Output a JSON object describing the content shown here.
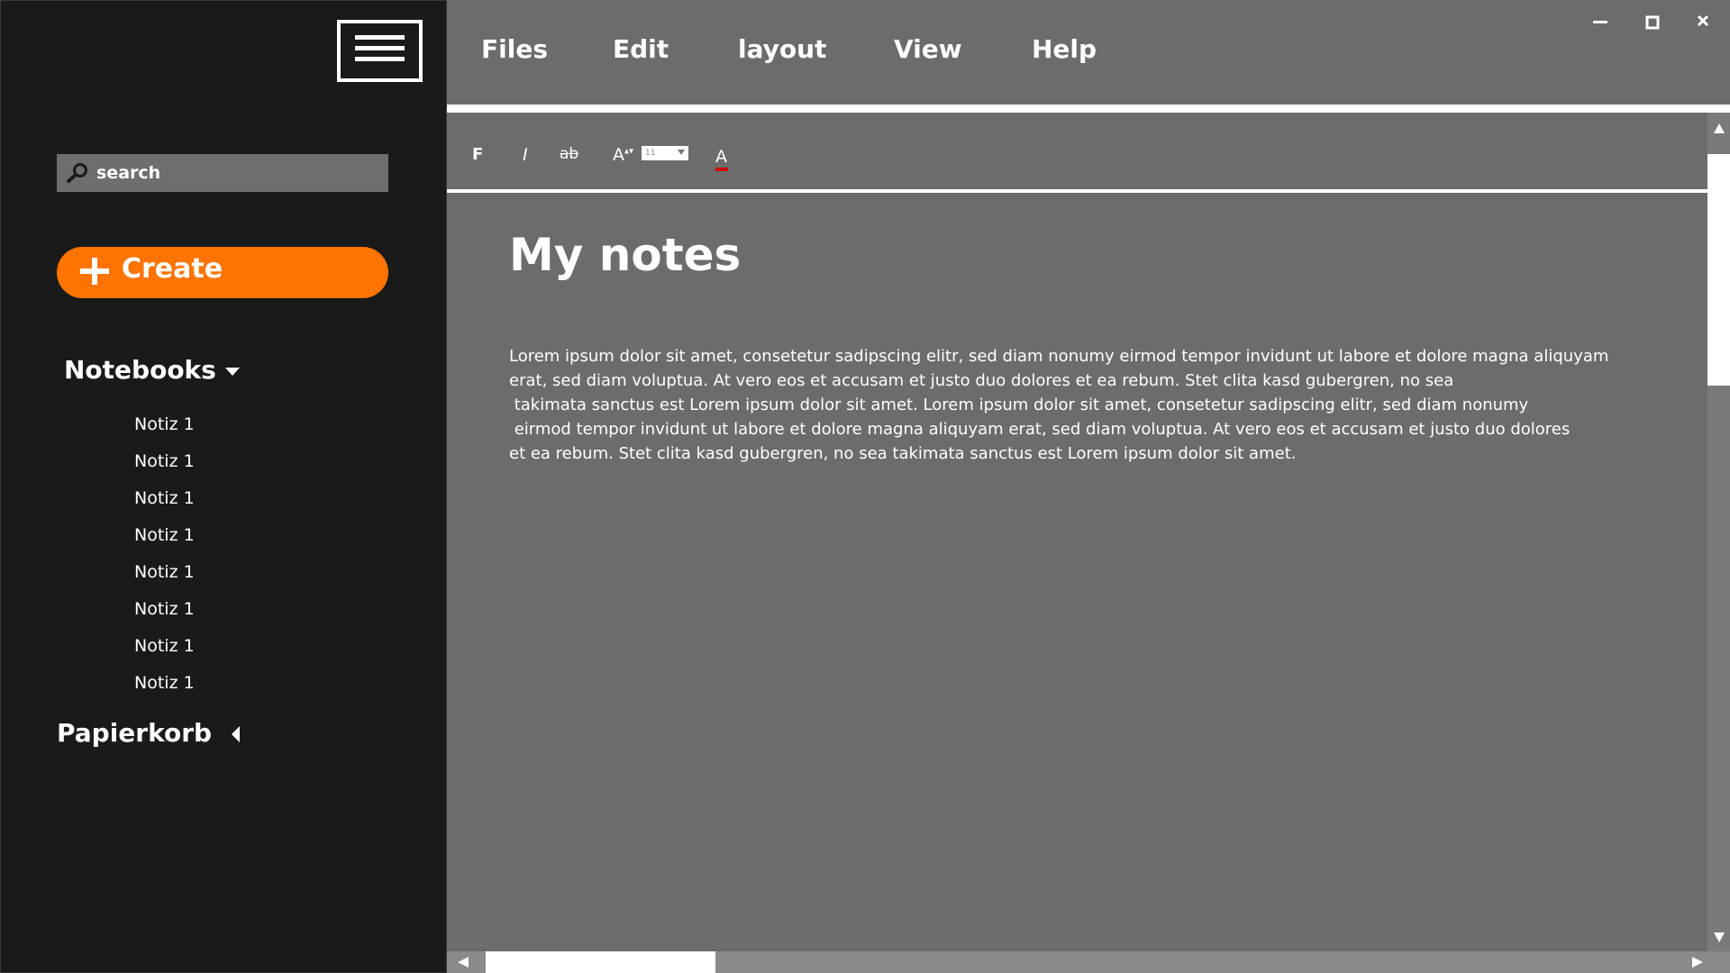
{
  "sidebar": {
    "search_placeholder": "search",
    "create_label": "Create",
    "notebooks_label": "Notebooks",
    "notes": [
      "Notiz 1",
      "Notiz 1",
      "Notiz 1",
      "Notiz 1",
      "Notiz 1",
      "Notiz 1",
      "Notiz 1",
      "Notiz 1"
    ],
    "trash_label": "Papierkorb"
  },
  "menubar": {
    "files": "Files",
    "edit": "Edit",
    "layout": "layout",
    "view": "View",
    "help": "Help"
  },
  "toolbar": {
    "bold": "F",
    "italic": "I",
    "strike": "ab",
    "font_size_icon": "A",
    "font_size_value": "11",
    "font_color": "A"
  },
  "editor": {
    "title": "My notes",
    "body_lines": [
      "Lorem ipsum dolor sit amet, consetetur sadipscing elitr, sed diam nonumy eirmod tempor invidunt ut labore et dolore magna aliquyam",
      "erat, sed diam voluptua. At vero eos et accusam et justo duo dolores et ea rebum. Stet clita kasd gubergren, no sea",
      " takimata sanctus est Lorem ipsum dolor sit amet. Lorem ipsum dolor sit amet, consetetur sadipscing elitr, sed diam nonumy",
      " eirmod tempor invidunt ut labore et dolore magna aliquyam erat, sed diam voluptua. At vero eos et accusam et justo duo dolores",
      "et ea rebum. Stet clita kasd gubergren, no sea takimata sanctus est Lorem ipsum dolor sit amet."
    ]
  },
  "colors": {
    "sidebar_bg": "#1a1a1a",
    "main_bg": "#6c6c6c",
    "accent": "#ff7400",
    "font_color_swatch": "#cc0000"
  },
  "icons": {
    "menu": "hamburger-icon",
    "search": "search-icon",
    "create": "plus-icon",
    "notebooks": "chevron-down-icon",
    "trash": "chevron-left-icon"
  }
}
